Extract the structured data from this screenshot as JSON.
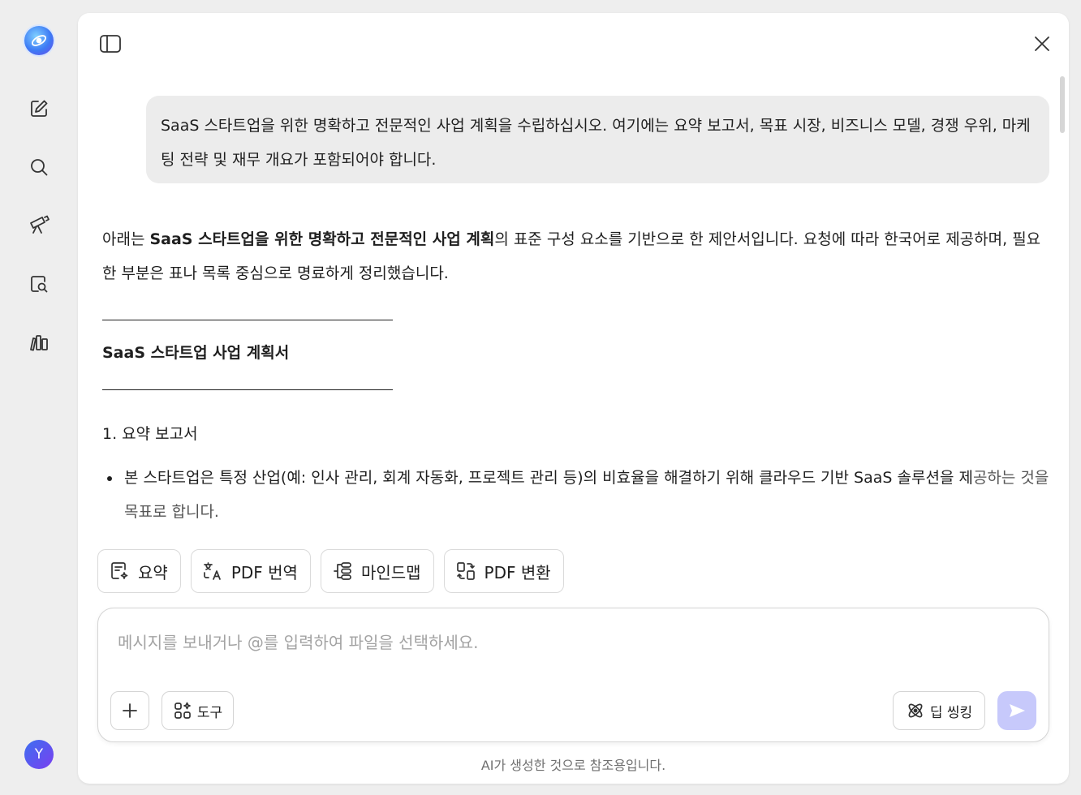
{
  "rail": {
    "items": [
      "new-chat",
      "search",
      "explore",
      "document-search",
      "library"
    ],
    "avatar_initial": "Y"
  },
  "conversation": {
    "user_message": "SaaS 스타트업을 위한 명확하고 전문적인 사업 계획을 수립하십시오. 여기에는 요약 보고서, 목표 시장, 비즈니스 모델, 경쟁 우위, 마케팅 전략 및 재무 개요가 포함되어야 합니다.",
    "intro_prefix": "아래는 ",
    "intro_bold": "SaaS 스타트업을 위한 명확하고 전문적인 사업 계획",
    "intro_suffix": "의 표준 구성 요소를 기반으로 한 제안서입니다. 요청에 따라 한국어로 제공하며, 필요한 부분은 표나 목록 중심으로 명료하게 정리했습니다.",
    "section_title": "SaaS 스타트업 사업 계획서",
    "heading_1": "1. 요약 보고서",
    "bullet_1_main": "본 스타트업은 특정 산업(예: 인사 관리, 회계 자동화, 프로젝트 관리 등)의 비효율을 해결하기 위해 클라우드 기반 SaaS 솔루션을 제",
    "bullet_1_fade": "공하는 것을 목표로 합니다."
  },
  "quick_actions": [
    {
      "label": "요약",
      "icon": "summary-icon"
    },
    {
      "label": "PDF 번역",
      "icon": "translate-icon"
    },
    {
      "label": "마인드맵",
      "icon": "mindmap-icon"
    },
    {
      "label": "PDF 변환",
      "icon": "convert-icon"
    }
  ],
  "composer": {
    "placeholder": "메시지를 보내거나 @를 입력하여 파일을 선택하세요.",
    "tools_label": "도구",
    "deep_thinking_label": "딥 씽킹"
  },
  "footer": {
    "disclaimer": "AI가 생성한 것으로 참조용입니다."
  },
  "colors": {
    "send_button": "#c7c9fb",
    "user_bubble": "#ececec",
    "app_background": "#eeeeee"
  }
}
